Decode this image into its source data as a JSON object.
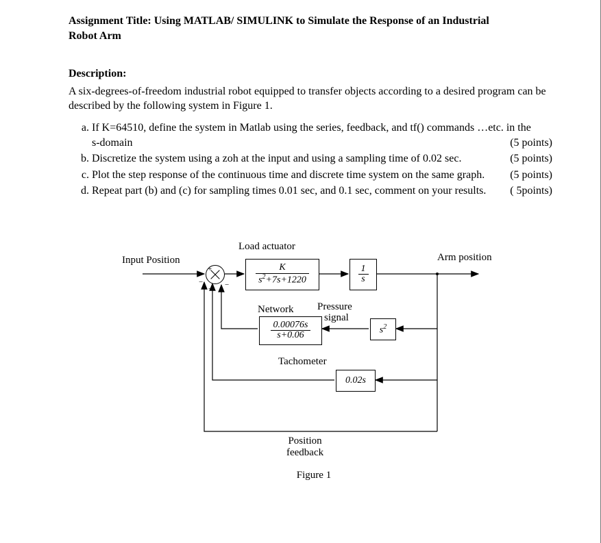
{
  "title_line1": "Assignment Title: Using MATLAB/ SIMULINK to Simulate the Response of an Industrial",
  "title_line2": "Robot Arm",
  "desc_label": "Description:",
  "intro": "A six-degrees-of-freedom industrial robot equipped to transfer objects according to a desired program can be described by the following system in Figure 1.",
  "tasks": {
    "a": {
      "text": "If K=64510, define the system in Matlab using the series, feedback, and tf() commands …etc. in the s-domain",
      "pts": "(5 points)"
    },
    "b": {
      "text": "Discretize the system using a zoh at the input and using a sampling time of 0.02 sec.",
      "pts": "(5 points)"
    },
    "c": {
      "text": "Plot the step response of the continuous time and discrete time system on the same graph.",
      "pts": "(5 points)"
    },
    "d": {
      "text": "Repeat part (b) and (c) for sampling times 0.01 sec, and 0.1 sec, comment on your results.",
      "pts": "( 5points)"
    }
  },
  "labels": {
    "input": "Input Position",
    "load_actuator": "Load actuator",
    "arm_pos": "Arm position",
    "network": "Network",
    "pressure": "Pressure",
    "signal": "signal",
    "tach": "Tachometer",
    "pos_fb1": "Position",
    "pos_fb2": "feedback",
    "figure": "Figure 1"
  },
  "tf": {
    "actuator_num": "K",
    "actuator_den_pre": "s",
    "actuator_den_sup": "2",
    "actuator_den_post": "+7s+1220",
    "integ_num": "1",
    "integ_den": "s",
    "net_num": "0.00076s",
    "net_den": "s+0.06",
    "press_pre": "s",
    "press_sup": "2",
    "tach_gain": "0.02s"
  }
}
